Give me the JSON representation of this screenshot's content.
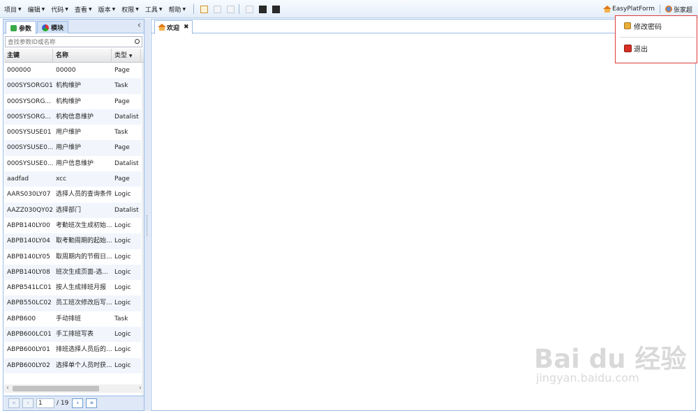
{
  "menu": [
    "项目",
    "编辑",
    "代码",
    "查看",
    "版本",
    "权限",
    "工具",
    "帮助"
  ],
  "toolbar_icons": [
    "new-file-icon",
    "save-icon",
    "copy-icon",
    "document-icon",
    "console-icon",
    "terminal-icon"
  ],
  "header": {
    "app_name": "EasyPlatForm",
    "user_name": "张家超"
  },
  "user_menu": {
    "change_password": "修改密码",
    "logout": "退出"
  },
  "left_panel": {
    "tabs": [
      "参数",
      "模块"
    ],
    "search_placeholder": "查找参数ID或名称",
    "columns": [
      "主键",
      "名称",
      "类型"
    ],
    "rows": [
      [
        "000000",
        "00000",
        "Page"
      ],
      [
        "000SYSORG01",
        "机构维护",
        "Task"
      ],
      [
        "000SYSORG...",
        "机构维护",
        "Page"
      ],
      [
        "000SYSORG...",
        "机构信息维护",
        "Datalist"
      ],
      [
        "000SYSUSE01",
        "用户维护",
        "Task"
      ],
      [
        "000SYSUSE0...",
        "用户维护",
        "Page"
      ],
      [
        "000SYSUSE0...",
        "用户信息维护",
        "Datalist"
      ],
      [
        "aadfad",
        "xcc",
        "Page"
      ],
      [
        "AARS030LY07",
        "选择人员的查询条件",
        "Logic"
      ],
      [
        "AAZZ030QY02",
        "选择部门",
        "Datalist"
      ],
      [
        "ABPB140LY00",
        "考勤班次生成初始...",
        "Logic"
      ],
      [
        "ABPB140LY04",
        "取考勤周期的起始...",
        "Logic"
      ],
      [
        "ABPB140LY05",
        "取周期内的节假日...",
        "Logic"
      ],
      [
        "ABPB140LY08",
        "班次生成页面-选...",
        "Logic"
      ],
      [
        "ABPB541LC01",
        "按人生成排班月报",
        "Logic"
      ],
      [
        "ABPB550LC02",
        "员工班次修改后写...",
        "Logic"
      ],
      [
        "ABPB600",
        "手动排班",
        "Task"
      ],
      [
        "ABPB600LC01",
        "手工排班写表",
        "Logic"
      ],
      [
        "ABPB600LY01",
        "排班选择人员后的...",
        "Logic"
      ],
      [
        "ABPB600LY02",
        "选择单个人员时获...",
        "Logic"
      ]
    ],
    "pager": {
      "current_page": "1",
      "total": "/ 19"
    }
  },
  "main_tabs": [
    "欢迎"
  ],
  "watermark": {
    "brand": "Bai du 经验",
    "url": "jingyan.baidu.com"
  },
  "colors": {
    "accent_border": "#99bbe8",
    "highlight_box": "#e23a3a",
    "tab_bg": "#dfe8f6"
  }
}
